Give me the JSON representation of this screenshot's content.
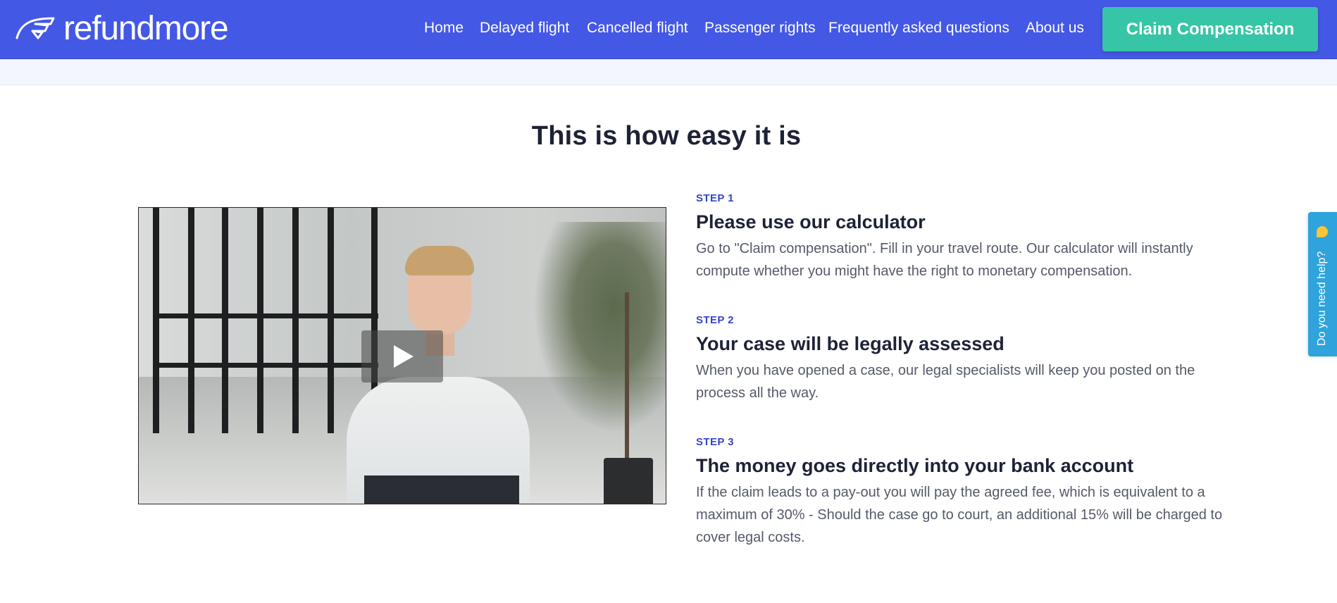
{
  "header": {
    "brand": "refundmore",
    "nav": [
      "Home",
      "Delayed flight",
      "Cancelled flight",
      "Passenger rights",
      "Frequently asked questions",
      "About us"
    ],
    "cta_label": "Claim Compensation"
  },
  "section": {
    "title": "This is how easy it is"
  },
  "steps": [
    {
      "label": "STEP 1",
      "title": "Please use our calculator",
      "text": "Go to \"Claim compensation\". Fill in your travel route. Our calculator will instantly compute whether you might have the right to monetary compensation."
    },
    {
      "label": "STEP 2",
      "title": "Your case will be legally assessed",
      "text": "When you have opened a case, our legal specialists will keep you posted on the process all the way."
    },
    {
      "label": "STEP 3",
      "title": "The money goes directly into your bank account",
      "text": "If the claim leads to a pay-out you will pay the agreed fee, which is equivalent to a maximum of 30% - Should the case go to court, an additional 15% will be charged to cover legal costs."
    }
  ],
  "help_tab": {
    "label": "Do you need help?",
    "icon": "hand-emoji-icon"
  },
  "colors": {
    "header_bg": "#4458e6",
    "cta_bg": "#36c5a6",
    "step_label": "#3545c9",
    "help_bg": "#2fa3dc"
  },
  "icons": {
    "logo": "wing-logo-icon",
    "video_play": "play-icon"
  }
}
